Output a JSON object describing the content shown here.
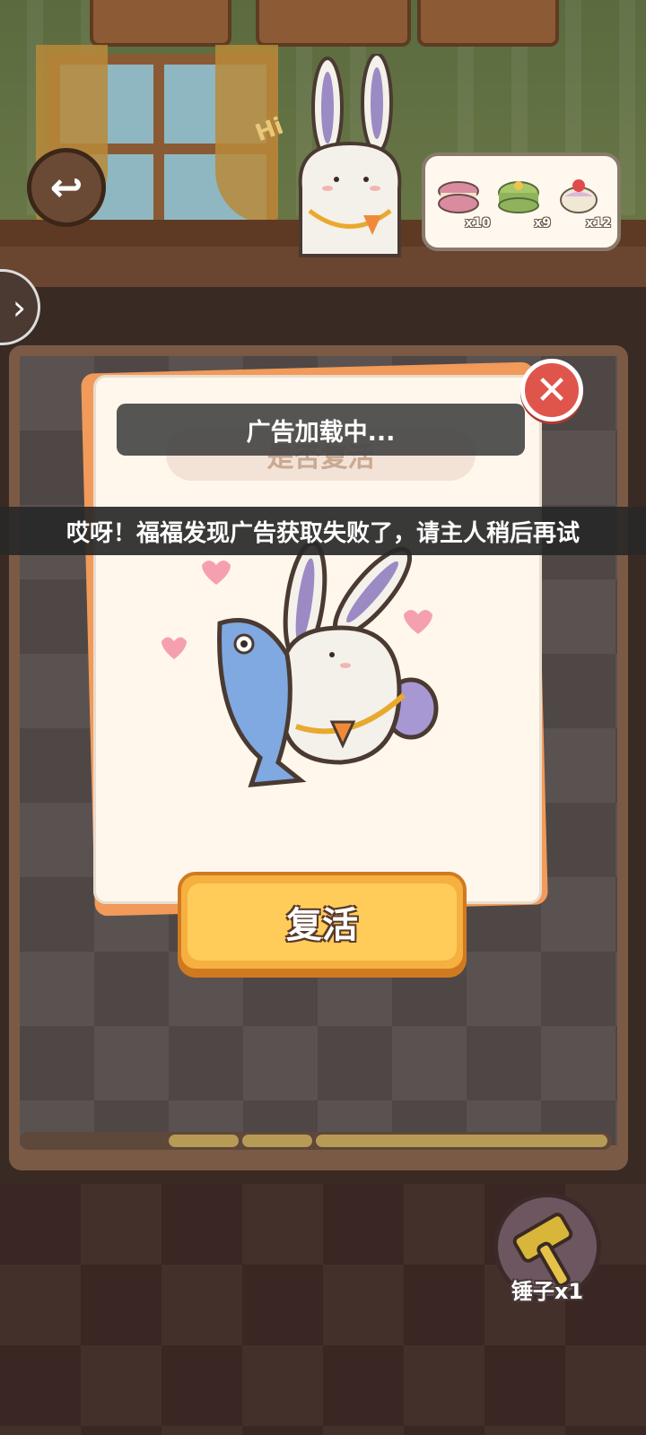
{
  "top_bar": {
    "back_icon": "undo-arrow-icon",
    "wall_sign": "Hi"
  },
  "items": [
    {
      "name": "macaron",
      "count": "x10",
      "color": "#d98ca0"
    },
    {
      "name": "matcha-cake",
      "count": "x9",
      "color": "#a7c86a"
    },
    {
      "name": "strawberry-cake",
      "count": "x12",
      "color": "#f1e7d5"
    }
  ],
  "dialog": {
    "title": "是否复活",
    "revive_label": "复活",
    "close_icon": "close-icon"
  },
  "toasts": {
    "loading": "广告加载中...",
    "error": "哎呀！福福发现广告获取失败了，请主人稍后再试"
  },
  "tools": {
    "hammer_label": "锤子x1"
  },
  "colors": {
    "accent_orange": "#f6b03f",
    "close_red": "#e0554b",
    "dialog_bg": "#fff7ec"
  }
}
